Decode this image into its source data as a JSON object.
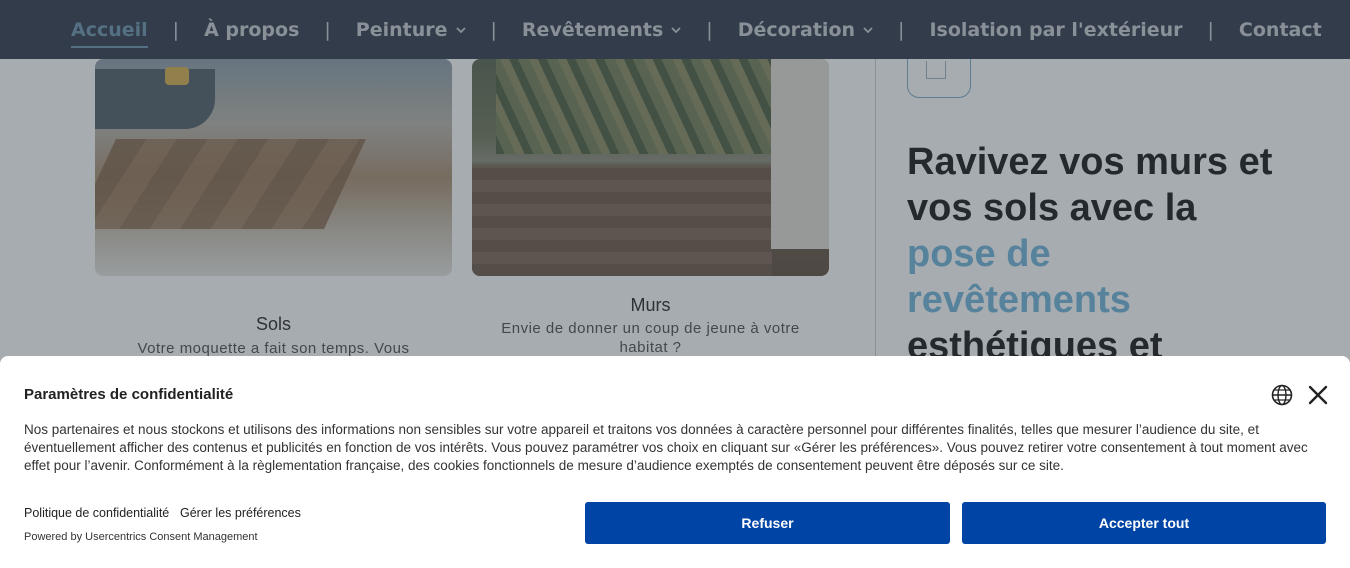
{
  "nav": {
    "items": [
      {
        "label": "Accueil",
        "active": true,
        "dropdown": false
      },
      {
        "label": "À propos",
        "dropdown": false
      },
      {
        "label": "Peinture",
        "dropdown": true
      },
      {
        "label": "Revêtements",
        "dropdown": true
      },
      {
        "label": "Décoration",
        "dropdown": true
      },
      {
        "label": "Isolation par l'extérieur",
        "dropdown": false
      },
      {
        "label": "Contact",
        "dropdown": false
      }
    ],
    "separator": "|"
  },
  "cards": {
    "sols": {
      "title": "Sols",
      "desc": "Votre moquette a fait son temps. Vous"
    },
    "murs": {
      "title": "Murs",
      "desc": "Envie de donner un coup de jeune à votre habitat ?"
    }
  },
  "hero": {
    "line1": "Ravivez vos murs et",
    "line2": "vos sols avec la",
    "accent1": "pose de",
    "accent2": "revêtements",
    "line3": "esthétiques et"
  },
  "consent": {
    "title": "Paramètres de confidentialité",
    "text": "Nos partenaires et nous stockons et utilisons des informations non sensibles sur votre appareil et traitons vos données à caractère personnel pour différentes finalités, telles que mesurer l’audience du site, et éventuellement afficher des contenus et publicités en fonction de vos intérêts. Vous pouvez paramétrer vos choix en cliquant sur «Gérer les préférences». Vous pouvez retirer votre consentement à tout moment avec effet pour l’avenir. Conformément à la règlementation française, des cookies fonctionnels de mesure d’audience exemptés de consentement peuvent être déposés sur ce site.",
    "privacy_link": "Politique de confidentialité",
    "prefs_link": "Gérer les préférences",
    "powered_by": "Powered by Usercentrics Consent Management",
    "refuse_label": "Refuser",
    "accept_label": "Accepter tout",
    "button_color": "#0045a5"
  },
  "colors": {
    "nav_bg": "#2b3446",
    "accent": "#6cb2db",
    "nav_active": "#6a93ad"
  }
}
